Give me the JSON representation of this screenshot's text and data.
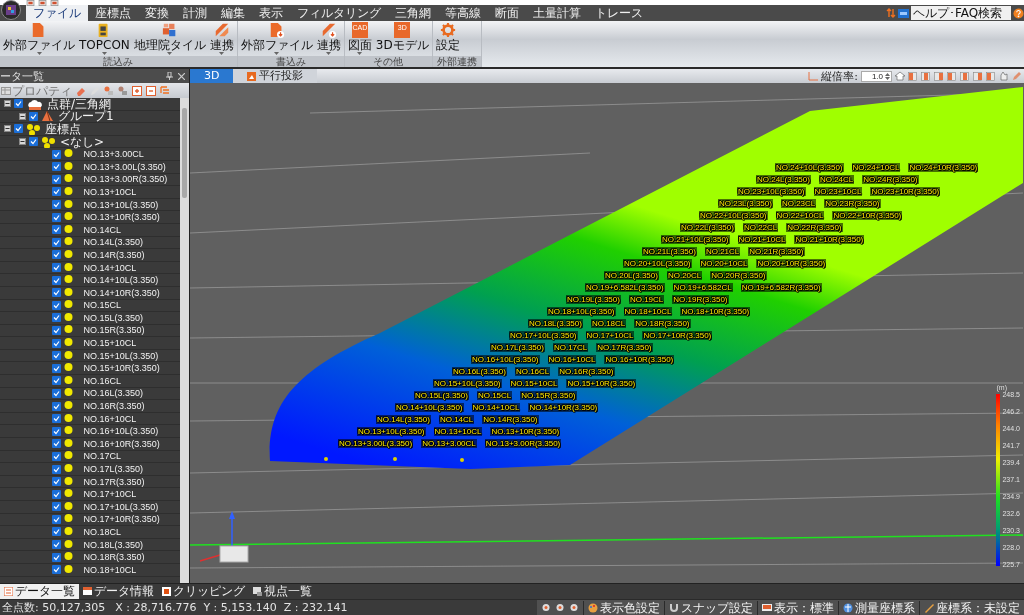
{
  "menu": {
    "tabs": [
      {
        "label": "ファイル",
        "selected": true
      },
      {
        "label": "座標点",
        "selected": false
      },
      {
        "label": "変換",
        "selected": false
      },
      {
        "label": "計測",
        "selected": false
      },
      {
        "label": "編集",
        "selected": false
      },
      {
        "label": "表示",
        "selected": false
      },
      {
        "label": "フィルタリング",
        "selected": false
      },
      {
        "label": "三角網",
        "selected": false
      },
      {
        "label": "等高線",
        "selected": false
      },
      {
        "label": "断面",
        "selected": false
      },
      {
        "label": "土量計算",
        "selected": false
      },
      {
        "label": "トレース",
        "selected": false
      }
    ],
    "help_search": {
      "value": "ヘルプ･FAQ検索"
    }
  },
  "ribbon": {
    "groups": [
      {
        "label": "読込み",
        "buttons": [
          {
            "label": "外部ファイル",
            "kind": "file",
            "dropdown": true
          },
          {
            "label": "TOPCON",
            "kind": "device",
            "dropdown": true
          },
          {
            "label": "地理院タイル",
            "kind": "tile",
            "dropdown": true
          },
          {
            "label": "連携",
            "kind": "link",
            "dropdown": true
          }
        ]
      },
      {
        "label": "書込み",
        "buttons": [
          {
            "label": "外部ファイル",
            "kind": "file-export",
            "dropdown": true
          },
          {
            "label": "連携",
            "kind": "link-export",
            "dropdown": true
          }
        ]
      },
      {
        "label": "その他",
        "buttons": [
          {
            "label": "図面",
            "kind": "badge",
            "badge": "CAD",
            "dropdown": true
          },
          {
            "label": "3Dモデル",
            "kind": "badge",
            "badge": "3D",
            "dropdown": false
          }
        ]
      },
      {
        "label": "外部連携",
        "buttons": [
          {
            "label": "設定",
            "kind": "gear",
            "dropdown": false
          }
        ]
      }
    ]
  },
  "data_panel": {
    "title": "ータ一覧",
    "property_button": {
      "label": "プロパティ",
      "disabled": true
    },
    "tree": [
      {
        "label": "点群/三角網",
        "kind": "cloud",
        "checked": true,
        "expanded": true,
        "children": [
          {
            "label": "グループ1",
            "kind": "mesh",
            "checked": true,
            "expanded": true
          }
        ]
      },
      {
        "label": "座標点",
        "kind": "points",
        "checked": true,
        "expanded": true,
        "children": [
          {
            "label": "<なし>",
            "kind": "points",
            "checked": true,
            "expanded": true,
            "children": [
              {
                "label": "NO.13+3.00CL",
                "kind": "point",
                "checked": true
              },
              {
                "label": "NO.13+3.00L(3.350)",
                "kind": "point",
                "checked": true
              },
              {
                "label": "NO.13+3.00R(3.350)",
                "kind": "point",
                "checked": true
              },
              {
                "label": "NO.13+10CL",
                "kind": "point",
                "checked": true
              },
              {
                "label": "NO.13+10L(3.350)",
                "kind": "point",
                "checked": true
              },
              {
                "label": "NO.13+10R(3.350)",
                "kind": "point",
                "checked": true
              },
              {
                "label": "NO.14CL",
                "kind": "point",
                "checked": true
              },
              {
                "label": "NO.14L(3.350)",
                "kind": "point",
                "checked": true
              },
              {
                "label": "NO.14R(3.350)",
                "kind": "point",
                "checked": true
              },
              {
                "label": "NO.14+10CL",
                "kind": "point",
                "checked": true
              },
              {
                "label": "NO.14+10L(3.350)",
                "kind": "point",
                "checked": true
              },
              {
                "label": "NO.14+10R(3.350)",
                "kind": "point",
                "checked": true
              },
              {
                "label": "NO.15CL",
                "kind": "point",
                "checked": true
              },
              {
                "label": "NO.15L(3.350)",
                "kind": "point",
                "checked": true
              },
              {
                "label": "NO.15R(3.350)",
                "kind": "point",
                "checked": true
              },
              {
                "label": "NO.15+10CL",
                "kind": "point",
                "checked": true
              },
              {
                "label": "NO.15+10L(3.350)",
                "kind": "point",
                "checked": true
              },
              {
                "label": "NO.15+10R(3.350)",
                "kind": "point",
                "checked": true
              },
              {
                "label": "NO.16CL",
                "kind": "point",
                "checked": true
              },
              {
                "label": "NO.16L(3.350)",
                "kind": "point",
                "checked": true
              },
              {
                "label": "NO.16R(3.350)",
                "kind": "point",
                "checked": true
              },
              {
                "label": "NO.16+10CL",
                "kind": "point",
                "checked": true
              },
              {
                "label": "NO.16+10L(3.350)",
                "kind": "point",
                "checked": true
              },
              {
                "label": "NO.16+10R(3.350)",
                "kind": "point",
                "checked": true
              },
              {
                "label": "NO.17CL",
                "kind": "point",
                "checked": true
              },
              {
                "label": "NO.17L(3.350)",
                "kind": "point",
                "checked": true
              },
              {
                "label": "NO.17R(3.350)",
                "kind": "point",
                "checked": true
              },
              {
                "label": "NO.17+10CL",
                "kind": "point",
                "checked": true
              },
              {
                "label": "NO.17+10L(3.350)",
                "kind": "point",
                "checked": true
              },
              {
                "label": "NO.17+10R(3.350)",
                "kind": "point",
                "checked": true
              },
              {
                "label": "NO.18CL",
                "kind": "point",
                "checked": true
              },
              {
                "label": "NO.18L(3.350)",
                "kind": "point",
                "checked": true
              },
              {
                "label": "NO.18R(3.350)",
                "kind": "point",
                "checked": true
              },
              {
                "label": "NO.18+10CL",
                "kind": "point",
                "checked": true
              }
            ]
          }
        ]
      }
    ],
    "bottom_tabs": [
      {
        "label": "データ一覧",
        "selected": true
      },
      {
        "label": "データ情報",
        "selected": false
      },
      {
        "label": "クリッピング",
        "selected": false
      },
      {
        "label": "視点一覧",
        "selected": false
      }
    ]
  },
  "view": {
    "tabs": [
      {
        "label": "3D",
        "selected": true
      },
      {
        "label": "平行投影",
        "selected": false
      }
    ],
    "scale_label": "縦倍率:",
    "scale_value": "1.0",
    "stations": [
      {
        "left": "NO.24+10L(3.350)",
        "center": "NO.24+10CL",
        "right": "NO.24+10R(3.350)"
      },
      {
        "left": "NO.24L(3.350)",
        "center": "NO.24CL",
        "right": "NO.24R(3.350)"
      },
      {
        "left": "NO.23+10L(3.350)",
        "center": "NO.23+10CL",
        "right": "NO.23+10R(3.350)"
      },
      {
        "left": "NO.23L(3.350)",
        "center": "NO.23CL",
        "right": "NO.23R(3.350)"
      },
      {
        "left": "NO.22+10L(3.350)",
        "center": "NO.22+10CL",
        "right": "NO.22+10R(3.350)"
      },
      {
        "left": "NO.22L(3.350)",
        "center": "NO.22CL",
        "right": "NO.22R(3.350)"
      },
      {
        "left": "NO.21+10L(3.350)",
        "center": "NO.21+10CL",
        "right": "NO.21+10R(3.350)"
      },
      {
        "left": "NO.21L(3.350)",
        "center": "NO.21CL",
        "right": "NO.21R(3.350)"
      },
      {
        "left": "NO.20+10L(3.350)",
        "center": "NO.20+10CL",
        "right": "NO.20+10R(3.350)"
      },
      {
        "left": "NO.20L(3.350)",
        "center": "NO.20CL",
        "right": "NO.20R(3.350)"
      },
      {
        "left": "NO.19+6.582L(3.350)",
        "center": "NO.19+6.582CL",
        "right": "NO.19+6.582R(3.350)"
      },
      {
        "left": "NO.19L(3.350)",
        "center": "NO.19CL",
        "right": "NO.19R(3.350)"
      },
      {
        "left": "NO.18+10L(3.350)",
        "center": "NO.18+10CL",
        "right": "NO.18+10R(3.350)"
      },
      {
        "left": "NO.18L(3.350)",
        "center": "NO.18CL",
        "right": "NO.18R(3.350)"
      },
      {
        "left": "NO.17+10L(3.350)",
        "center": "NO.17+10CL",
        "right": "NO.17+10R(3.350)"
      },
      {
        "left": "NO.17L(3.350)",
        "center": "NO.17CL",
        "right": "NO.17R(3.350)"
      },
      {
        "left": "NO.16+10L(3.350)",
        "center": "NO.16+10CL",
        "right": "NO.16+10R(3.350)"
      },
      {
        "left": "NO.16L(3.350)",
        "center": "NO.16CL",
        "right": "NO.16R(3.350)"
      },
      {
        "left": "NO.15+10L(3.350)",
        "center": "NO.15+10CL",
        "right": "NO.15+10R(3.350)"
      },
      {
        "left": "NO.15L(3.350)",
        "center": "NO.15CL",
        "right": "NO.15R(3.350)"
      },
      {
        "left": "NO.14+10L(3.350)",
        "center": "NO.14+10CL",
        "right": "NO.14+10R(3.350)"
      },
      {
        "left": "NO.14L(3.350)",
        "center": "NO.14CL",
        "right": "NO.14R(3.350)"
      },
      {
        "left": "NO.13+10L(3.350)",
        "center": "NO.13+10CL",
        "right": "NO.13+10R(3.350)"
      },
      {
        "left": "NO.13+3.00L(3.350)",
        "center": "NO.13+3.00CL",
        "right": "NO.13+3.00R(3.350)"
      }
    ],
    "legend": {
      "unit": "(m)",
      "ticks": [
        "248.5",
        "246.2",
        "244.0",
        "241.7",
        "239.4",
        "237.1",
        "234.9",
        "232.6",
        "230.3",
        "228.0",
        "225.7"
      ]
    }
  },
  "status_bar": {
    "point_count": "全点数: 50,127,305",
    "coords": "X : 28,716.776  Y : 5,153.140  Z : 232.141",
    "items": [
      {
        "label": "表示色設定",
        "kind": "palette"
      },
      {
        "label": "スナップ設定",
        "kind": "magnet"
      },
      {
        "label": "表示：標準",
        "kind": "monitor"
      },
      {
        "label": "測量座標系",
        "kind": "globe"
      },
      {
        "label": "座標系：未設定",
        "kind": "ruler"
      }
    ]
  }
}
